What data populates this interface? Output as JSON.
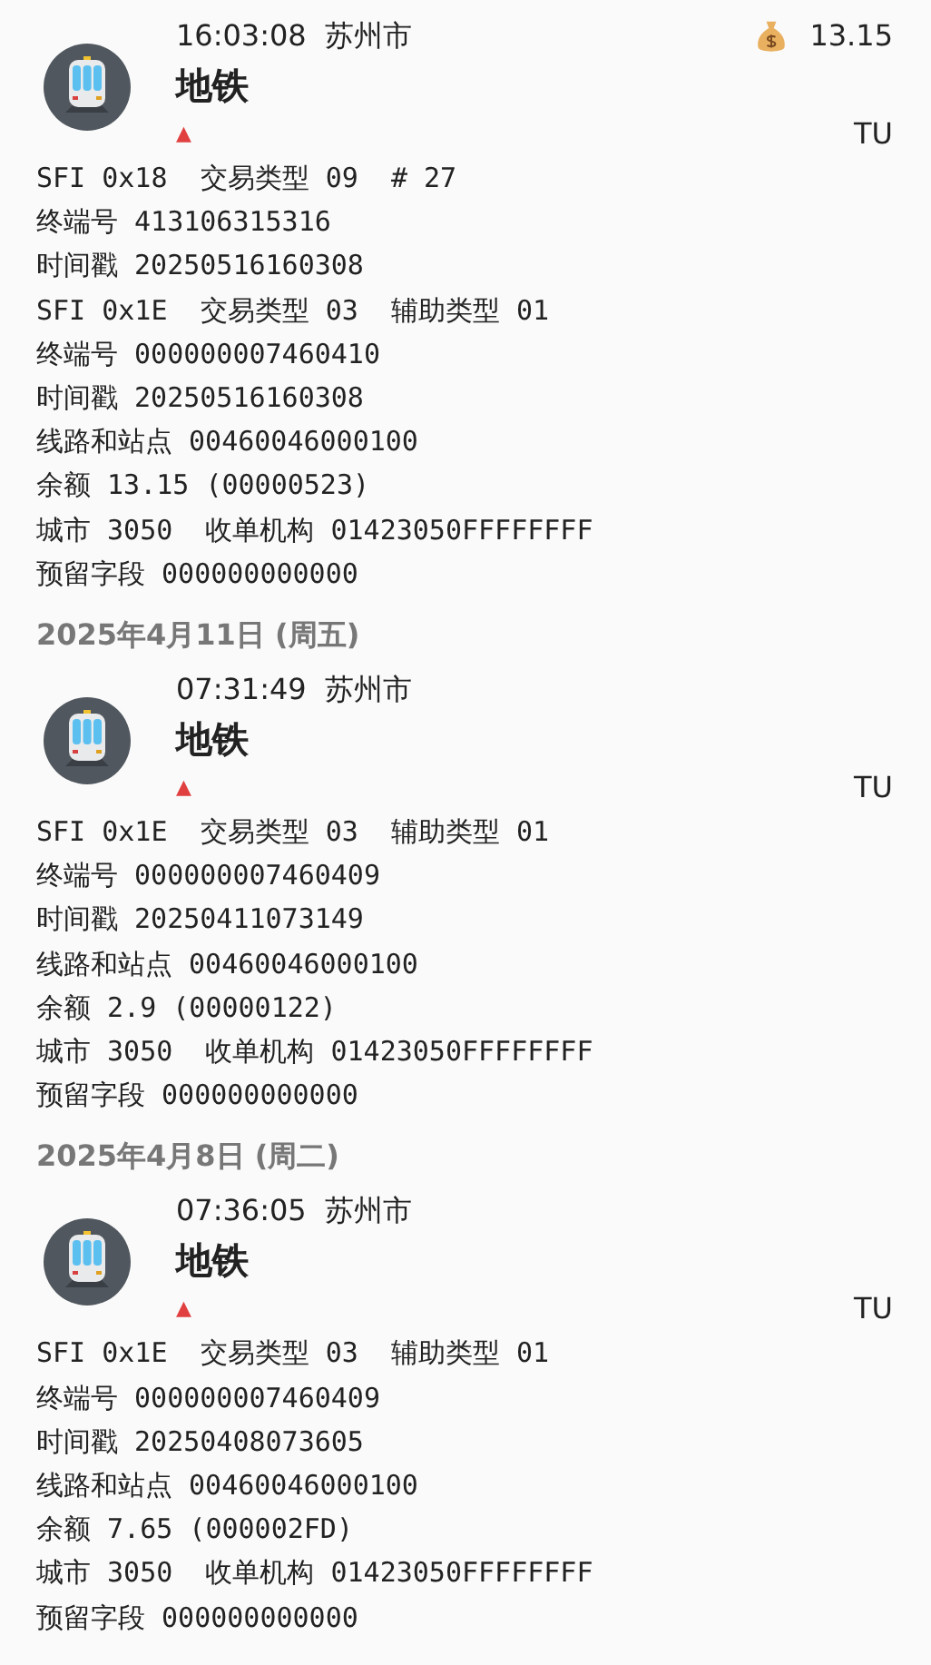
{
  "sections": [
    {
      "records": [
        {
          "time": "16:03:08",
          "city": "苏州市",
          "title": "地铁",
          "direction": "▲",
          "tag": "TU",
          "amount": "13.15",
          "lines": [
            "SFI 0x18  交易类型 09  # 27",
            "终端号 413106315316",
            "时间戳 20250516160308",
            "SFI 0x1E  交易类型 03  辅助类型 01",
            "终端号 000000007460410",
            "时间戳 20250516160308",
            "线路和站点 00460046000100",
            "余额 13.15 (00000523)",
            "城市 3050  收单机构 01423050FFFFFFFF",
            "预留字段 000000000000"
          ]
        }
      ]
    },
    {
      "date": "2025年4月11日 (周五)",
      "records": [
        {
          "time": "07:31:49",
          "city": "苏州市",
          "title": "地铁",
          "direction": "▲",
          "tag": "TU",
          "lines": [
            "SFI 0x1E  交易类型 03  辅助类型 01",
            "终端号 000000007460409",
            "时间戳 20250411073149",
            "线路和站点 00460046000100",
            "余额 2.9 (00000122)",
            "城市 3050  收单机构 01423050FFFFFFFF",
            "预留字段 000000000000"
          ]
        }
      ]
    },
    {
      "date": "2025年4月8日 (周二)",
      "records": [
        {
          "time": "07:36:05",
          "city": "苏州市",
          "title": "地铁",
          "direction": "▲",
          "tag": "TU",
          "lines": [
            "SFI 0x1E  交易类型 03  辅助类型 01",
            "终端号 000000007460409",
            "时间戳 20250408073605",
            "线路和站点 00460046000100",
            "余额 7.65 (000002FD)",
            "城市 3050  收单机构 01423050FFFFFFFF",
            "预留字段 000000000000"
          ]
        }
      ]
    }
  ]
}
